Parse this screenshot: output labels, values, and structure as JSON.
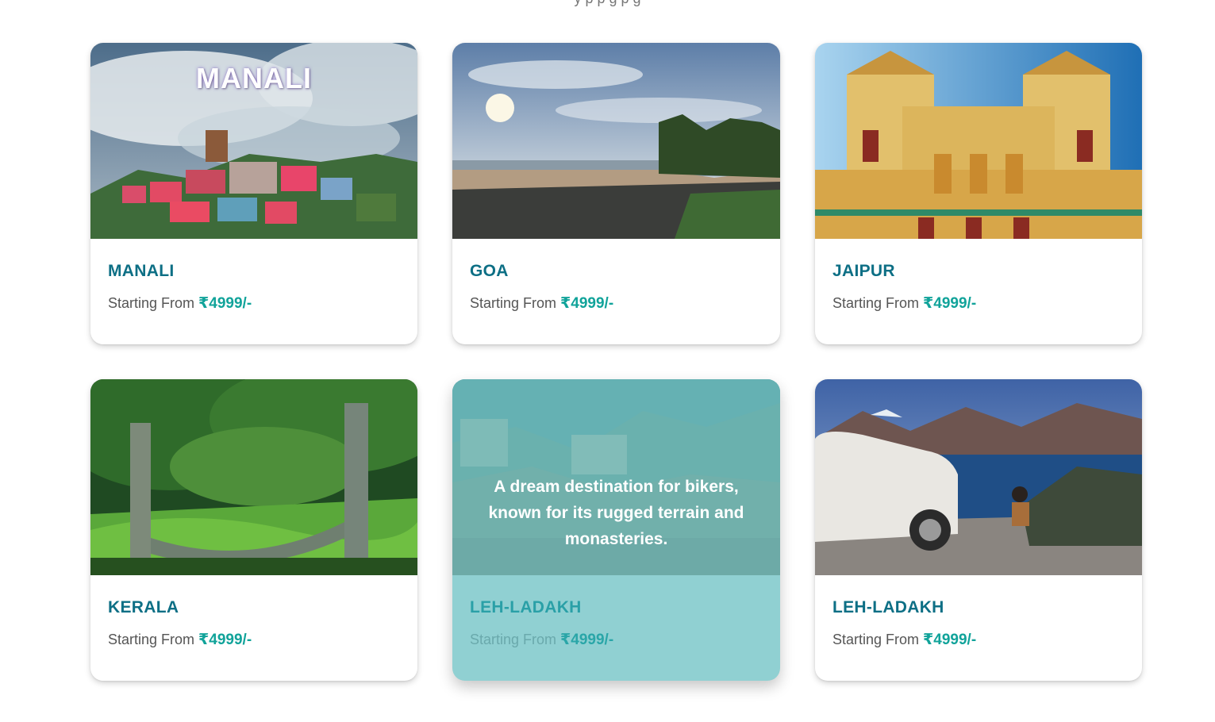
{
  "header": {
    "cutoff_text": "y  p     p                                                             g    p     g"
  },
  "cards": [
    {
      "title": "MANALI",
      "price_prefix": "Starting From",
      "price": "₹4999/-",
      "image_caption": "MANALI",
      "image": "mountain-town-photo"
    },
    {
      "title": "GOA",
      "price_prefix": "Starting From",
      "price": "₹4999/-",
      "image": "beach-photo"
    },
    {
      "title": "JAIPUR",
      "price_prefix": "Starting From",
      "price": "₹4999/-",
      "image": "palace-photo"
    },
    {
      "title": "KERALA",
      "price_prefix": "Starting From",
      "price": "₹4999/-",
      "image": "garden-photo"
    },
    {
      "title": "LEH-LADAKH",
      "price_prefix": "Starting From",
      "price": "₹4999/-",
      "image": "monastery-photo",
      "hover_text": "A dream destination for bikers, known for its rugged terrain and monasteries."
    },
    {
      "title": "LEH-LADAKH",
      "price_prefix": "Starting From",
      "price": "₹4999/-",
      "image": "lake-camp-photo"
    }
  ],
  "colors": {
    "title": "#0d6f85",
    "price": "#11a39a",
    "hover_card": "#90d0d2",
    "overlay": "#68bebe"
  }
}
